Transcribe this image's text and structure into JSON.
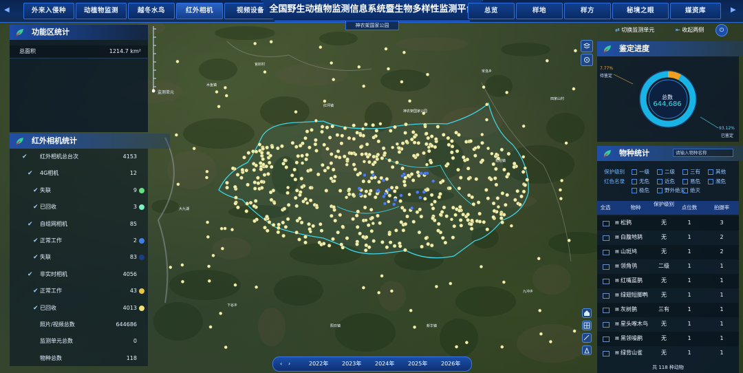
{
  "nav": {
    "left_tabs": [
      "外来入侵种",
      "动植物监测",
      "越冬水鸟",
      "红外相机",
      "视频设备"
    ],
    "right_tabs": [
      "总览",
      "样地",
      "样方",
      "秘境之眼",
      "媒资库"
    ],
    "active_tab": "红外相机",
    "title": "全国野生动植物监测信息系统暨生物多样性监测平台",
    "subtitle": "神农架国家公园"
  },
  "functional": {
    "title": "功能区统计",
    "total_label": "总面积",
    "total_value": "1214.7 km²"
  },
  "cameras": {
    "title": "红外相机统计",
    "rows": [
      {
        "label": "红外相机总台次",
        "value": "4153",
        "indent": 0,
        "check": true,
        "dot": ""
      },
      {
        "label": "4G相机",
        "value": "12",
        "indent": 1,
        "check": true,
        "dot": ""
      },
      {
        "label": "失联",
        "value": "9",
        "indent": 2,
        "check": true,
        "dot": "#63e07f"
      },
      {
        "label": "已回收",
        "value": "3",
        "indent": 2,
        "check": true,
        "dot": "#7bf2c0"
      },
      {
        "label": "自组网相机",
        "value": "85",
        "indent": 1,
        "check": true,
        "dot": ""
      },
      {
        "label": "正常工作",
        "value": "2",
        "indent": 2,
        "check": true,
        "dot": "#3f7fe8"
      },
      {
        "label": "失联",
        "value": "83",
        "indent": 2,
        "check": true,
        "dot": "#1a3f82"
      },
      {
        "label": "非实时相机",
        "value": "4056",
        "indent": 1,
        "check": true,
        "dot": ""
      },
      {
        "label": "正常工作",
        "value": "43",
        "indent": 2,
        "check": true,
        "dot": "#e8c63f"
      },
      {
        "label": "已回收",
        "value": "4013",
        "indent": 2,
        "check": true,
        "dot": "#f3e070"
      },
      {
        "label": "照片/视频总数",
        "value": "644686",
        "indent": 1,
        "check": false,
        "dot": ""
      },
      {
        "label": "监测单元总数",
        "value": "0",
        "indent": 1,
        "check": false,
        "dot": ""
      },
      {
        "label": "物种总数",
        "value": "118",
        "indent": 1,
        "check": false,
        "dot": ""
      }
    ]
  },
  "right_top": {
    "switch_label": "切换监测单元",
    "collapse_label": "收起两侧"
  },
  "identification": {
    "title": "鉴定进度",
    "total_label": "总数",
    "total_value": "644,686",
    "pending_pct": "7.77%",
    "pending_label": "待鉴定",
    "done_pct": "93.12%",
    "done_label": "已鉴定",
    "pending_fraction": 0.0777
  },
  "species": {
    "title": "物种统计",
    "search_placeholder": "请输入物种名称",
    "protect_label": "保护级别",
    "protect_opts": [
      "一级",
      "二级",
      "三有",
      "其他"
    ],
    "redlist_label": "红色名录",
    "redlist_opts": [
      "无危",
      "近危",
      "易危",
      "濒危",
      "极危",
      "野外绝灭",
      "绝灭"
    ],
    "headers": {
      "select": "全选",
      "name": "物种",
      "level": "保护级别",
      "points": "点位数",
      "rate": "拍摄率"
    },
    "rows": [
      {
        "name": "松鸦",
        "level": "无",
        "points": "1",
        "rate": "3"
      },
      {
        "name": "白腹地鸫",
        "level": "无",
        "points": "1",
        "rate": "2"
      },
      {
        "name": "山斑鸠",
        "level": "无",
        "points": "1",
        "rate": "2"
      },
      {
        "name": "领角鸮",
        "level": "二级",
        "points": "1",
        "rate": "1"
      },
      {
        "name": "红嘴蓝鹊",
        "level": "无",
        "points": "1",
        "rate": "1"
      },
      {
        "name": "绿翅短脚鹎",
        "level": "无",
        "points": "1",
        "rate": "1"
      },
      {
        "name": "灰树鹊",
        "level": "三有",
        "points": "1",
        "rate": "1"
      },
      {
        "name": "星头啄木鸟",
        "level": "无",
        "points": "1",
        "rate": "1"
      },
      {
        "name": "黑领噪鹛",
        "level": "无",
        "points": "1",
        "rate": "1"
      },
      {
        "name": "绿背山雀",
        "level": "无",
        "points": "1",
        "rate": "1"
      }
    ],
    "footer": "共 118 种动物"
  },
  "timeline": {
    "years": [
      "2022年",
      "2023年",
      "2024年",
      "2025年",
      "2026年"
    ]
  },
  "map": {
    "zoom_label": "监测单元",
    "place_labels": [
      "神农架国家公园",
      "木鱼镇",
      "宋洛乡",
      "红坪镇",
      "大九湖",
      "九冲乡",
      "下谷乡",
      "阳日镇",
      "新华镇",
      "松柏镇",
      "官封村",
      "田家山村"
    ],
    "colors": {
      "points": "#f2f0b0",
      "boundary": "#3fd6e8",
      "ring": "#1ab3e6",
      "ring_pending": "#f0a020"
    }
  }
}
